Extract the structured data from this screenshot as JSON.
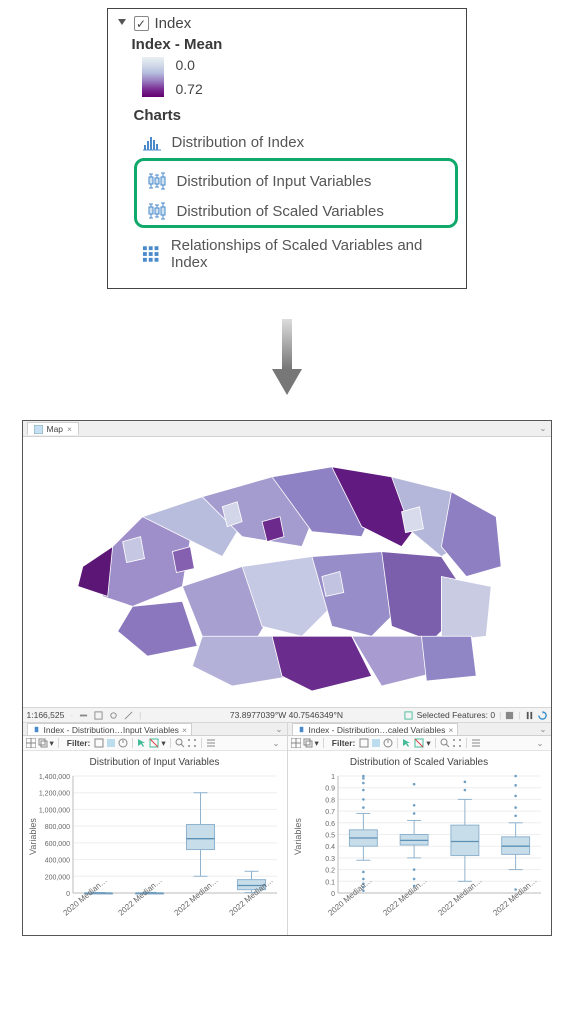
{
  "toc": {
    "layer_name": "Index",
    "legend_title": "Index - Mean",
    "ramp_min": "0.0",
    "ramp_max": "0.72",
    "charts_header": "Charts",
    "charts": {
      "histogram": "Distribution of Index",
      "box_input": "Distribution of Input Variables",
      "box_scaled": "Distribution of Scaled Variables",
      "matrix": "Relationships of Scaled Variables and Index"
    }
  },
  "app": {
    "map_tab": "Map",
    "scale": "1:166,525",
    "coord": "73.8977039°W 40.7546349°N",
    "selected_features_label": "Selected Features: 0",
    "chartA_tab": "Index - Distribution…Input Variables",
    "chartB_tab": "Index - Distribution…caled Variables",
    "filter_label": "Filter:",
    "chartA_title": "Distribution of Input Variables",
    "chartB_title": "Distribution of Scaled Variables",
    "ylabel": "Variables",
    "x_categories": [
      "2020 Median…",
      "2022 Median…",
      "2022 Median…",
      "2022 Median…"
    ]
  },
  "chart_data": [
    {
      "type": "boxplot",
      "title": "Distribution of Input Variables",
      "xlabel": "",
      "ylabel": "Variables",
      "ylim": [
        0,
        1400000
      ],
      "yticks": [
        0,
        200000,
        400000,
        600000,
        800000,
        1000000,
        1200000,
        1400000
      ],
      "categories": [
        "2020 Median…",
        "2022 Median…",
        "2022 Median…",
        "2022 Median…"
      ],
      "series": [
        {
          "name": "2020 Median…",
          "min": 0,
          "q1": 0,
          "median": 0,
          "q3": 0,
          "max": 5000,
          "outliers": []
        },
        {
          "name": "2022 Median…",
          "min": 0,
          "q1": 0,
          "median": 0,
          "q3": 0,
          "max": 7000,
          "outliers": []
        },
        {
          "name": "2022 Median…",
          "min": 200000,
          "q1": 520000,
          "median": 650000,
          "q3": 820000,
          "max": 1200000,
          "outliers": []
        },
        {
          "name": "2022 Median…",
          "min": 5000,
          "q1": 40000,
          "median": 90000,
          "q3": 160000,
          "max": 260000,
          "outliers": []
        }
      ]
    },
    {
      "type": "boxplot",
      "title": "Distribution of Scaled Variables",
      "xlabel": "",
      "ylabel": "Variables",
      "ylim": [
        0,
        1
      ],
      "yticks": [
        0,
        0.1,
        0.2,
        0.3,
        0.4,
        0.5,
        0.6,
        0.7,
        0.8,
        0.9,
        1
      ],
      "categories": [
        "2020 Median…",
        "2022 Median…",
        "2022 Median…",
        "2022 Median…"
      ],
      "series": [
        {
          "name": "2020 Median…",
          "min": 0.28,
          "q1": 0.4,
          "median": 0.47,
          "q3": 0.54,
          "max": 0.68,
          "outliers": [
            0.02,
            0.05,
            0.08,
            0.12,
            0.18,
            0.73,
            0.8,
            0.88,
            0.94,
            0.98,
            1.0
          ]
        },
        {
          "name": "2022 Median…",
          "min": 0.3,
          "q1": 0.41,
          "median": 0.45,
          "q3": 0.5,
          "max": 0.62,
          "outliers": [
            0.06,
            0.12,
            0.2,
            0.68,
            0.75,
            0.93
          ]
        },
        {
          "name": "2022 Median…",
          "min": 0.1,
          "q1": 0.32,
          "median": 0.44,
          "q3": 0.58,
          "max": 0.8,
          "outliers": [
            0.88,
            0.95
          ]
        },
        {
          "name": "2022 Median…",
          "min": 0.2,
          "q1": 0.33,
          "median": 0.4,
          "q3": 0.48,
          "max": 0.6,
          "outliers": [
            0.03,
            0.66,
            0.73,
            0.83,
            0.92,
            1.0
          ]
        }
      ]
    }
  ]
}
